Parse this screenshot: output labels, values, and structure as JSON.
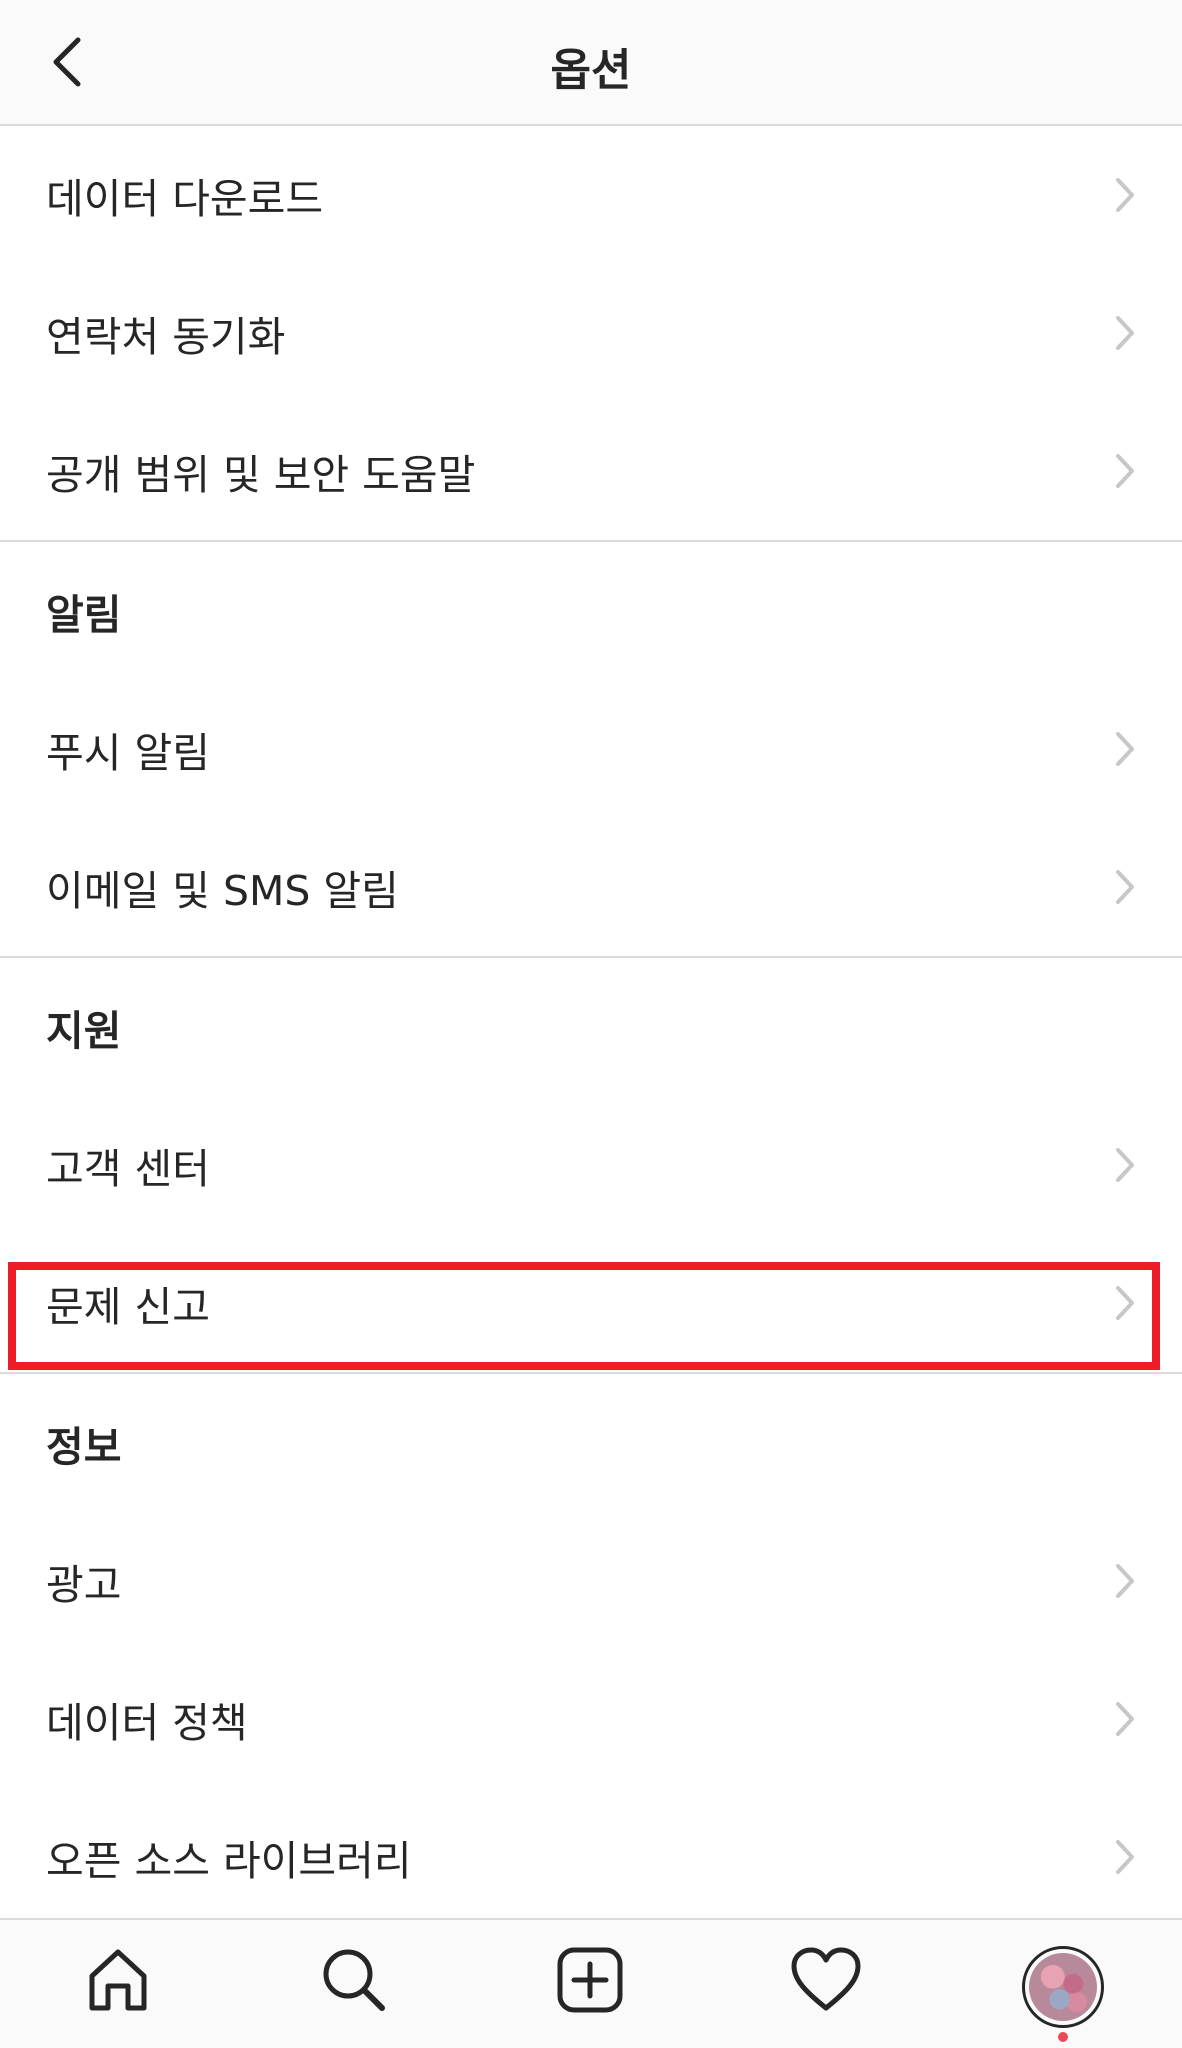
{
  "header": {
    "title": "옵션",
    "back_icon": "chevron-left-icon"
  },
  "groups": [
    {
      "title": "",
      "items": [
        {
          "label": "데이터 다운로드"
        },
        {
          "label": "연락처 동기화"
        },
        {
          "label": "공개 범위 및 보안 도움말"
        }
      ]
    },
    {
      "title": "알림",
      "items": [
        {
          "label": "푸시 알림"
        },
        {
          "label": "이메일 및 SMS 알림"
        }
      ]
    },
    {
      "title": "지원",
      "items": [
        {
          "label": "고객 센터"
        },
        {
          "label": "문제 신고",
          "highlighted": true
        }
      ]
    },
    {
      "title": "정보",
      "items": [
        {
          "label": "광고"
        },
        {
          "label": "데이터 정책"
        },
        {
          "label": "오픈 소스 라이브러리"
        }
      ]
    }
  ],
  "highlight_color": "#ee1c25",
  "tabbar": {
    "tabs": [
      "home-icon",
      "search-icon",
      "add-post-icon",
      "heart-icon",
      "profile-avatar"
    ],
    "notification_dot_color": "#ed4956"
  }
}
